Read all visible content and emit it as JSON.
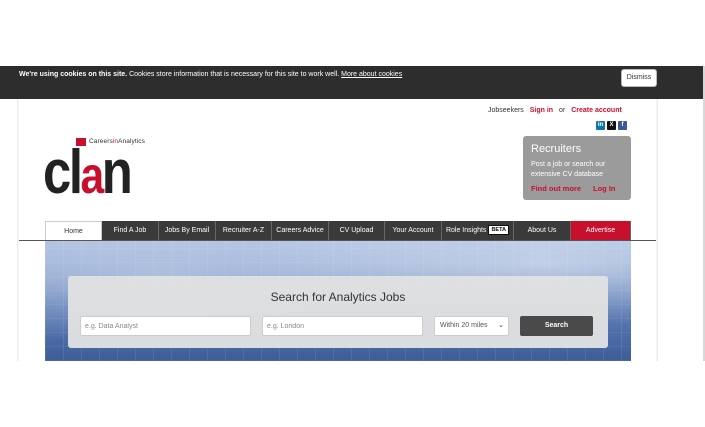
{
  "cookie": {
    "bold": "We're using cookies on this site.",
    "text": " Cookies store information that is necessary for this site to work well. ",
    "link": "More about cookies",
    "dismiss": "Dismiss"
  },
  "account": {
    "jobseekers": "Jobseekers",
    "sign_in": "Sign in",
    "or": "or",
    "create": "Create account"
  },
  "social": {
    "linkedin": "in",
    "x": "X",
    "facebook": "f"
  },
  "logo": {
    "tag_pre": "Careers",
    "tag_mid": "in",
    "tag_post": "Analytics",
    "c": "c",
    "l": "l",
    "a": "a",
    "n": "n"
  },
  "recruiters": {
    "title": "Recruiters",
    "desc": "Post a job or search our extensive CV database",
    "find_out": "Find out more",
    "login": "Log In"
  },
  "nav": {
    "items": [
      "Home",
      "Find A Job",
      "Jobs By Email",
      "Recruiter A-Z",
      "Careers Advice",
      "CV Upload",
      "Your Account",
      "Role Insights",
      "About Us",
      "Advertise"
    ],
    "beta": "BETA"
  },
  "search": {
    "title": "Search for Analytics Jobs",
    "keyword_placeholder": "e.g. Data Analyst",
    "location_placeholder": "e.g. London",
    "radius": "Within 20 miles",
    "button": "Search"
  },
  "colors": {
    "brand_red": "#c8102e",
    "nav_dark": "#3a3a3a",
    "cookie_bg": "#2d2d2d"
  }
}
